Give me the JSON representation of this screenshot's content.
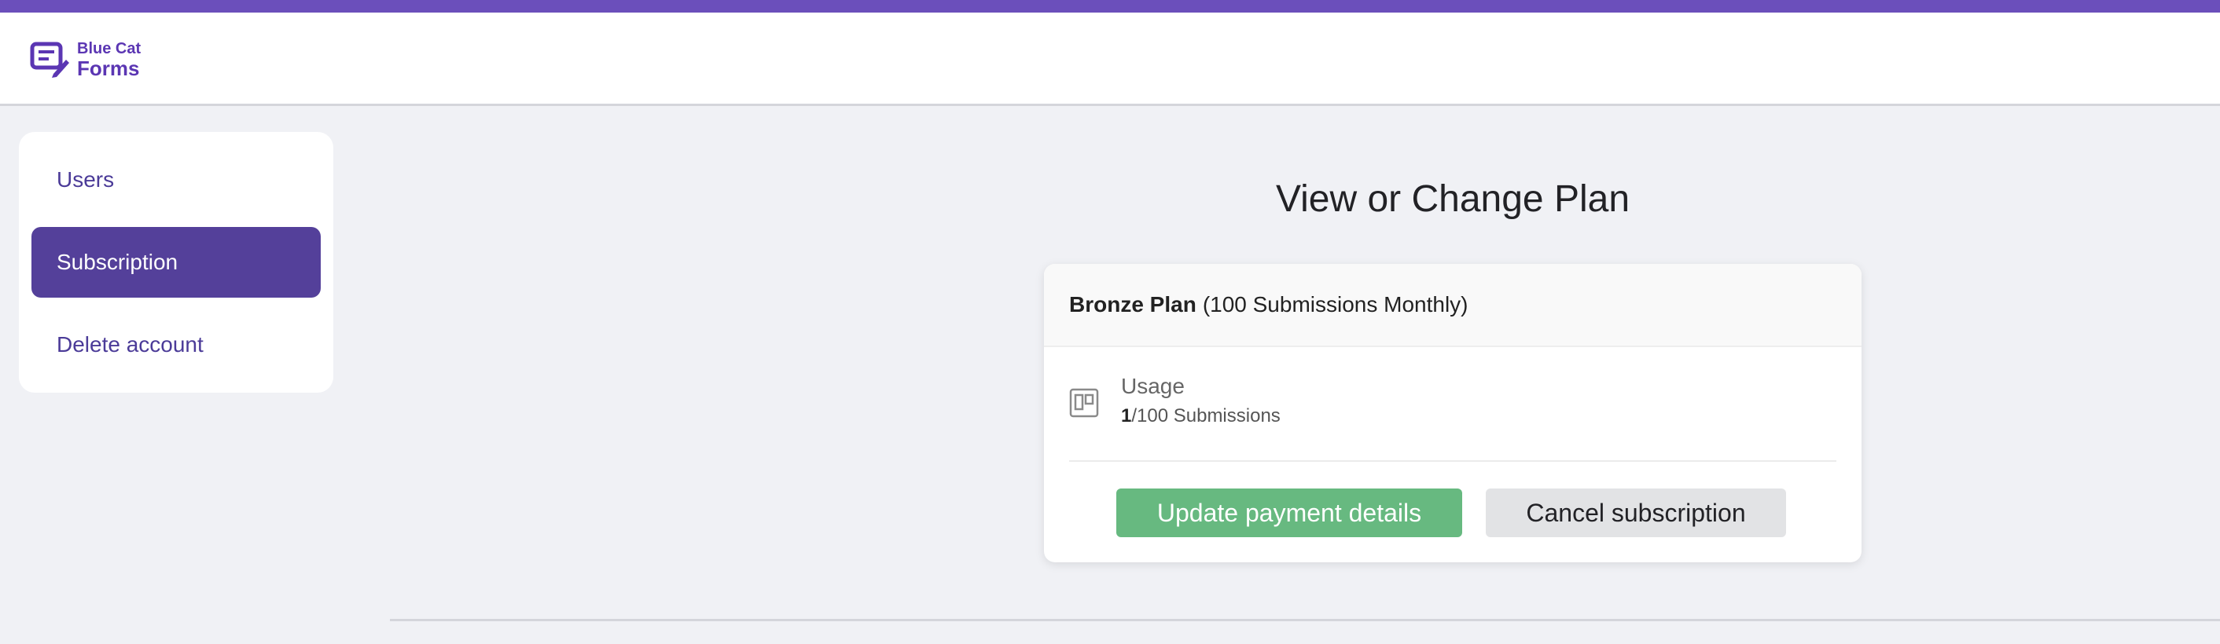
{
  "brand": {
    "line1": "Blue Cat",
    "line2": "Forms",
    "logo_icon": "form-edit-icon",
    "accent": "#6b4fbb"
  },
  "sidebar": {
    "items": [
      {
        "label": "Users",
        "active": false
      },
      {
        "label": "Subscription",
        "active": true
      },
      {
        "label": "Delete account",
        "active": false
      }
    ]
  },
  "main": {
    "title": "View or Change Plan",
    "plan": {
      "name": "Bronze Plan",
      "detail": "(100 Submissions Monthly)"
    },
    "usage": {
      "label": "Usage",
      "icon": "columns-icon",
      "count": "1",
      "total_text": "/100 Submissions"
    },
    "buttons": {
      "update_label": "Update payment details",
      "update_color": "#67b980",
      "cancel_label": "Cancel subscription"
    }
  }
}
